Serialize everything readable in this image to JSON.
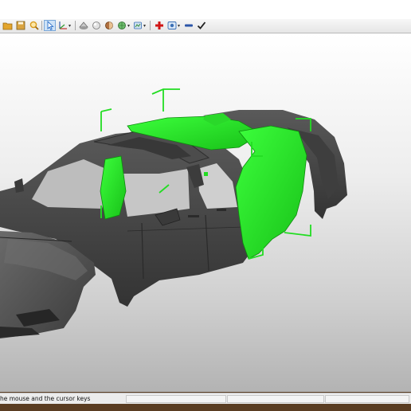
{
  "toolbar": {
    "items": [
      {
        "name": "open-folder-icon",
        "color": "#e3a52c"
      },
      {
        "name": "save-icon",
        "color": "#d9a441"
      },
      {
        "name": "zoom-icon",
        "color": "#d89a1c"
      },
      {
        "name": "select-pointer-icon",
        "color": "#2b6fc9"
      },
      {
        "name": "axis-transform-icon",
        "color": "#3a5fa8"
      },
      {
        "name": "render-mode-icon",
        "color": "#8a8a8a"
      },
      {
        "name": "light-icon",
        "color": "#7a7a7a"
      },
      {
        "name": "material-icon",
        "color": "#c96a2a"
      },
      {
        "name": "texture-icon",
        "color": "#3e9a3e"
      },
      {
        "name": "add-icon",
        "color": "#d01515"
      },
      {
        "name": "view-options-icon",
        "color": "#3a6fb5"
      },
      {
        "name": "minus-icon",
        "color": "#2c56a8"
      },
      {
        "name": "confirm-check-icon",
        "color": "#222222"
      }
    ]
  },
  "viewport": {
    "background_top": "#ffffff",
    "background_bottom": "#b3b3b3",
    "model_color": "#4a4a4a",
    "selection_color": "#22dd22"
  },
  "status": {
    "text": "he mouse and the cursor keys"
  },
  "window_frame_color": "#5a3d22"
}
